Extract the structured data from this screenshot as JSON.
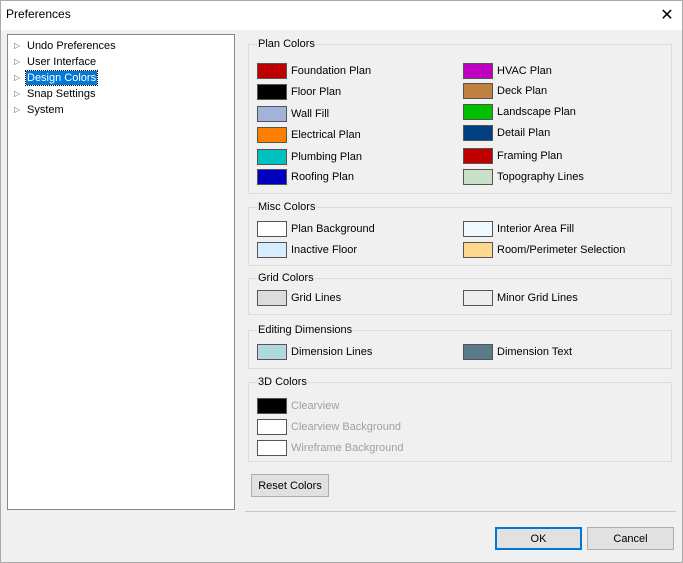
{
  "window": {
    "title": "Preferences",
    "close_glyph": "✕"
  },
  "tree": {
    "items": [
      {
        "label": "Undo Preferences"
      },
      {
        "label": "User Interface"
      },
      {
        "label": "Design Colors",
        "selected": true
      },
      {
        "label": "Snap Settings"
      },
      {
        "label": "System"
      }
    ]
  },
  "groups": {
    "plan": {
      "title": "Plan Colors",
      "left": [
        {
          "label": "Foundation Plan",
          "color": "#c00000"
        },
        {
          "label": "Floor Plan",
          "color": "#000000"
        },
        {
          "label": "Wall Fill",
          "color": "#9fb4d8"
        },
        {
          "label": "Electrical Plan",
          "color": "#ff8000"
        },
        {
          "label": "Plumbing Plan",
          "color": "#00c0c0"
        },
        {
          "label": "Roofing Plan",
          "color": "#0000c0"
        }
      ],
      "right": [
        {
          "label": "HVAC Plan",
          "color": "#c000c0"
        },
        {
          "label": "Deck Plan",
          "color": "#c08040"
        },
        {
          "label": "Landscape Plan",
          "color": "#00c000"
        },
        {
          "label": "Detail Plan",
          "color": "#004080"
        },
        {
          "label": "Framing Plan",
          "color": "#c00000"
        },
        {
          "label": "Topography Lines",
          "color": "#c8e0c8"
        }
      ]
    },
    "misc": {
      "title": "Misc Colors",
      "left": [
        {
          "label": "Plan Background",
          "color": "#ffffff"
        },
        {
          "label": "Inactive Floor",
          "color": "#d8ecff"
        }
      ],
      "right": [
        {
          "label": "Interior Area Fill",
          "color": "#f0f8ff"
        },
        {
          "label": "Room/Perimeter Selection",
          "color": "#ffd890"
        }
      ]
    },
    "grid": {
      "title": "Grid Colors",
      "left": [
        {
          "label": "Grid Lines",
          "color": "#dcdcdc"
        }
      ],
      "right": [
        {
          "label": "Minor Grid Lines",
          "color": "#ececec"
        }
      ]
    },
    "editing": {
      "title": "Editing Dimensions",
      "left": [
        {
          "label": "Dimension Lines",
          "color": "#b0d8e0"
        }
      ],
      "right": [
        {
          "label": "Dimension Text",
          "color": "#5a7a88"
        }
      ]
    },
    "three_d": {
      "title": "3D Colors",
      "left": [
        {
          "label": "Clearview",
          "color": "#000000"
        },
        {
          "label": "Clearview Background",
          "color": "#ffffff"
        },
        {
          "label": "Wireframe Background",
          "color": "#ffffff"
        }
      ]
    }
  },
  "buttons": {
    "reset": "Reset Colors",
    "ok": "OK",
    "cancel": "Cancel"
  }
}
